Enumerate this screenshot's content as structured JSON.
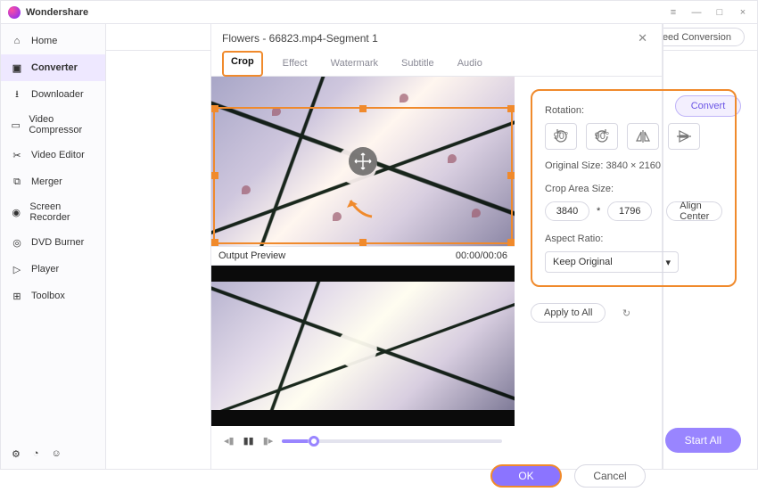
{
  "app": {
    "name": "Wondershare"
  },
  "window_controls": {
    "menu": "≡",
    "minimize": "—",
    "maximize": "□",
    "close": "×"
  },
  "sidebar": {
    "items": [
      {
        "label": "Home",
        "icon": "home-icon"
      },
      {
        "label": "Converter",
        "icon": "converter-icon",
        "active": true
      },
      {
        "label": "Downloader",
        "icon": "download-icon"
      },
      {
        "label": "Video Compressor",
        "icon": "compress-icon"
      },
      {
        "label": "Video Editor",
        "icon": "scissors-icon"
      },
      {
        "label": "Merger",
        "icon": "merge-icon"
      },
      {
        "label": "Screen Recorder",
        "icon": "record-icon"
      },
      {
        "label": "DVD Burner",
        "icon": "disc-icon"
      },
      {
        "label": "Player",
        "icon": "play-icon"
      },
      {
        "label": "Toolbox",
        "icon": "grid-icon"
      }
    ],
    "footer": [
      "settings-icon",
      "bell-icon",
      "user-icon"
    ]
  },
  "topstrip": {
    "speed_label": "Speed Conversion",
    "convert_label": "Convert"
  },
  "startall_label": "Start All",
  "modal": {
    "title": "Flowers - 66823.mp4-Segment 1",
    "tabs": [
      "Crop",
      "Effect",
      "Watermark",
      "Subtitle",
      "Audio"
    ],
    "active_tab": 0,
    "output_preview_label": "Output Preview",
    "timecode": "00:00/00:06",
    "rotation_label": "Rotation:",
    "rotation_buttons": [
      "rotate-ccw",
      "rotate-cw",
      "flip-h",
      "flip-v"
    ],
    "original_size_text": "Original Size:   3840 × 2160",
    "crop_area_label": "Crop Area Size:",
    "crop_w": "3840",
    "crop_mult": "*",
    "crop_h": "1796",
    "align_center_label": "Align Center",
    "aspect_label": "Aspect Ratio:",
    "aspect_value": "Keep Original",
    "apply_all_label": "Apply to All",
    "ok_label": "OK",
    "cancel_label": "Cancel"
  }
}
